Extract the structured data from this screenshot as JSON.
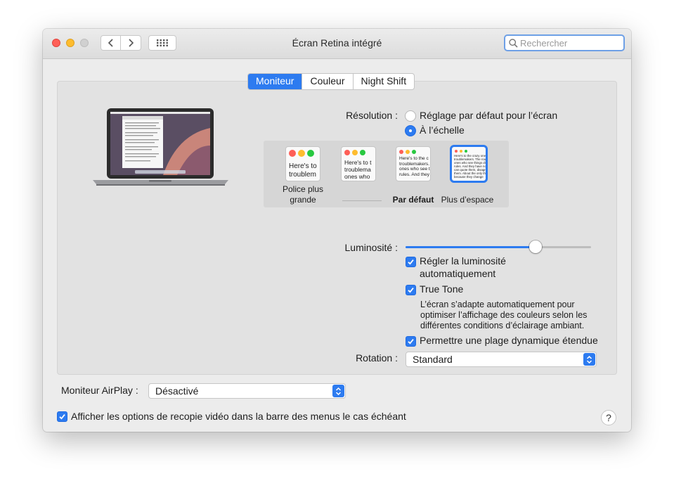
{
  "window": {
    "title": "Écran Retina intégré"
  },
  "toolbar": {
    "search_placeholder": "Rechercher"
  },
  "tabs": [
    {
      "label": "Moniteur",
      "active": true
    },
    {
      "label": "Couleur",
      "active": false
    },
    {
      "label": "Night Shift",
      "active": false
    }
  ],
  "resolution": {
    "label": "Résolution :",
    "options": [
      {
        "label": "Réglage par défaut pour l’écran",
        "selected": false
      },
      {
        "label": "À l’échelle",
        "selected": true
      }
    ],
    "scales": [
      {
        "label": "Police plus grande",
        "preview": "Here's to\ntroublem",
        "selected": false
      },
      {
        "label": "",
        "preview": "Here's to t\ntroublema\nones who",
        "selected": false
      },
      {
        "label": "Par défaut",
        "preview": "Here's to the c\ntroublemakers.\nones who see t\nrules. And they",
        "selected": false
      },
      {
        "label": "Plus d’espace",
        "preview": "Here's to the crazy one\ntroublemakers. The rou\nones who see things dif\nrules. And they have no\ncan quote them, disagre\nthem. About the only th\nbecause they change",
        "selected": true
      }
    ]
  },
  "brightness": {
    "label": "Luminosité :",
    "level": 0.7
  },
  "auto_brightness": {
    "label": "Régler la luminosité automatiquement",
    "checked": true
  },
  "true_tone": {
    "label": "True Tone",
    "checked": true,
    "description": "L’écran s’adapte automatiquement pour optimiser l’affichage des couleurs selon les différentes conditions d’éclairage ambiant."
  },
  "hdr": {
    "label": "Permettre une plage dynamique étendue",
    "checked": true
  },
  "rotation": {
    "label": "Rotation :",
    "value": "Standard"
  },
  "airplay": {
    "label": "Moniteur AirPlay :",
    "value": "Désactivé"
  },
  "mirroring_option": {
    "label": "Afficher les options de recopie vidéo dans la barre des menus le cas échéant",
    "checked": true
  },
  "help": {
    "label": "?"
  },
  "colors": {
    "accent": "#2d7bf0",
    "close": "#fe5f57",
    "minimize": "#febc2e"
  }
}
